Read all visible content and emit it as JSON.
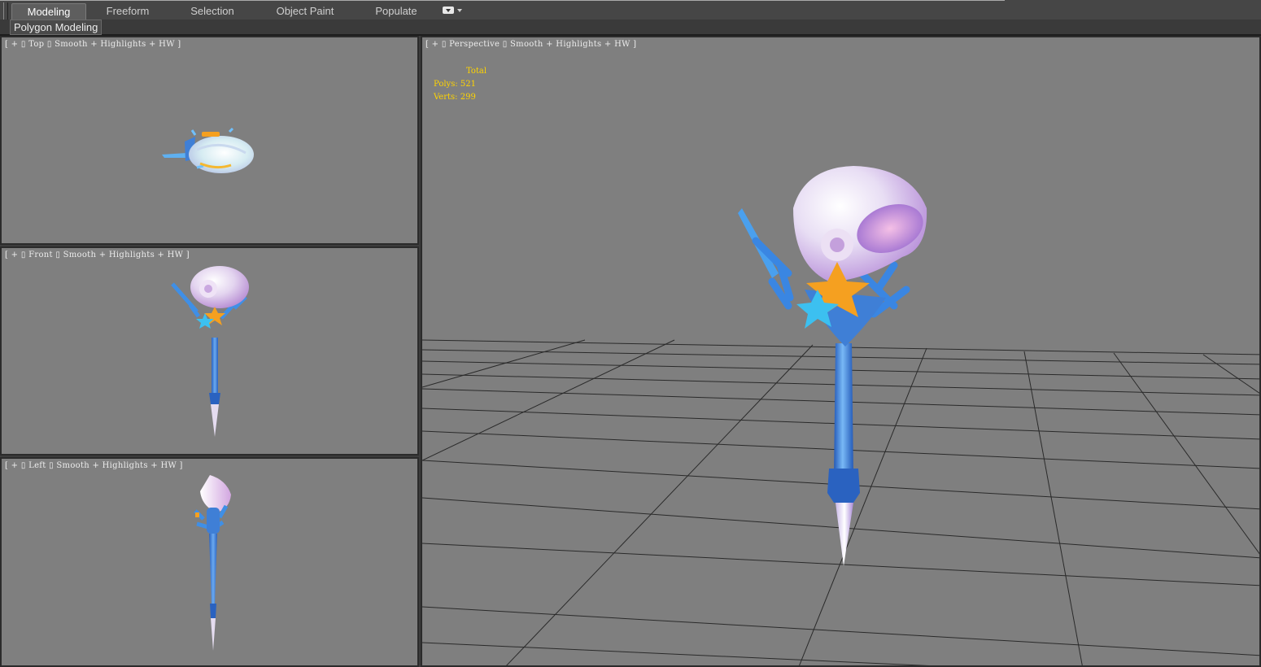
{
  "ribbon": {
    "tabs": [
      {
        "label": "Modeling",
        "active": true
      },
      {
        "label": "Freeform",
        "active": false
      },
      {
        "label": "Selection",
        "active": false
      },
      {
        "label": "Object Paint",
        "active": false
      },
      {
        "label": "Populate",
        "active": false
      }
    ],
    "panel_label": "Polygon Modeling"
  },
  "viewports": {
    "top": {
      "bracket_open": "[ + ",
      "name": "Top",
      "shading": "Smooth + Highlights + HW",
      "bracket_close": " ]"
    },
    "front": {
      "bracket_open": "[ + ",
      "name": "Front",
      "shading": "Smooth + Highlights + HW",
      "bracket_close": " ]"
    },
    "left": {
      "bracket_open": "[ + ",
      "name": "Left",
      "shading": "Smooth + Highlights + HW",
      "bracket_close": " ]"
    },
    "perspective": {
      "bracket_open": "[ + ",
      "name": "Perspective",
      "shading": "Smooth + Highlights + HW",
      "bracket_close": " ]"
    }
  },
  "stats": {
    "header": "Total",
    "polys_label": "Polys:",
    "polys_value": "521",
    "verts_label": "Verts:",
    "verts_value": "299"
  },
  "colors": {
    "viewport_bg": "#7f7f7f",
    "stats_text": "#ffd400",
    "staff_blue": "#3f7fd6",
    "shell_pink": "#d9b8e6",
    "star_orange": "#f5a020",
    "star_cyan": "#3cc0f0"
  },
  "icons": [
    "viewport-menu-dropdown-icon"
  ]
}
